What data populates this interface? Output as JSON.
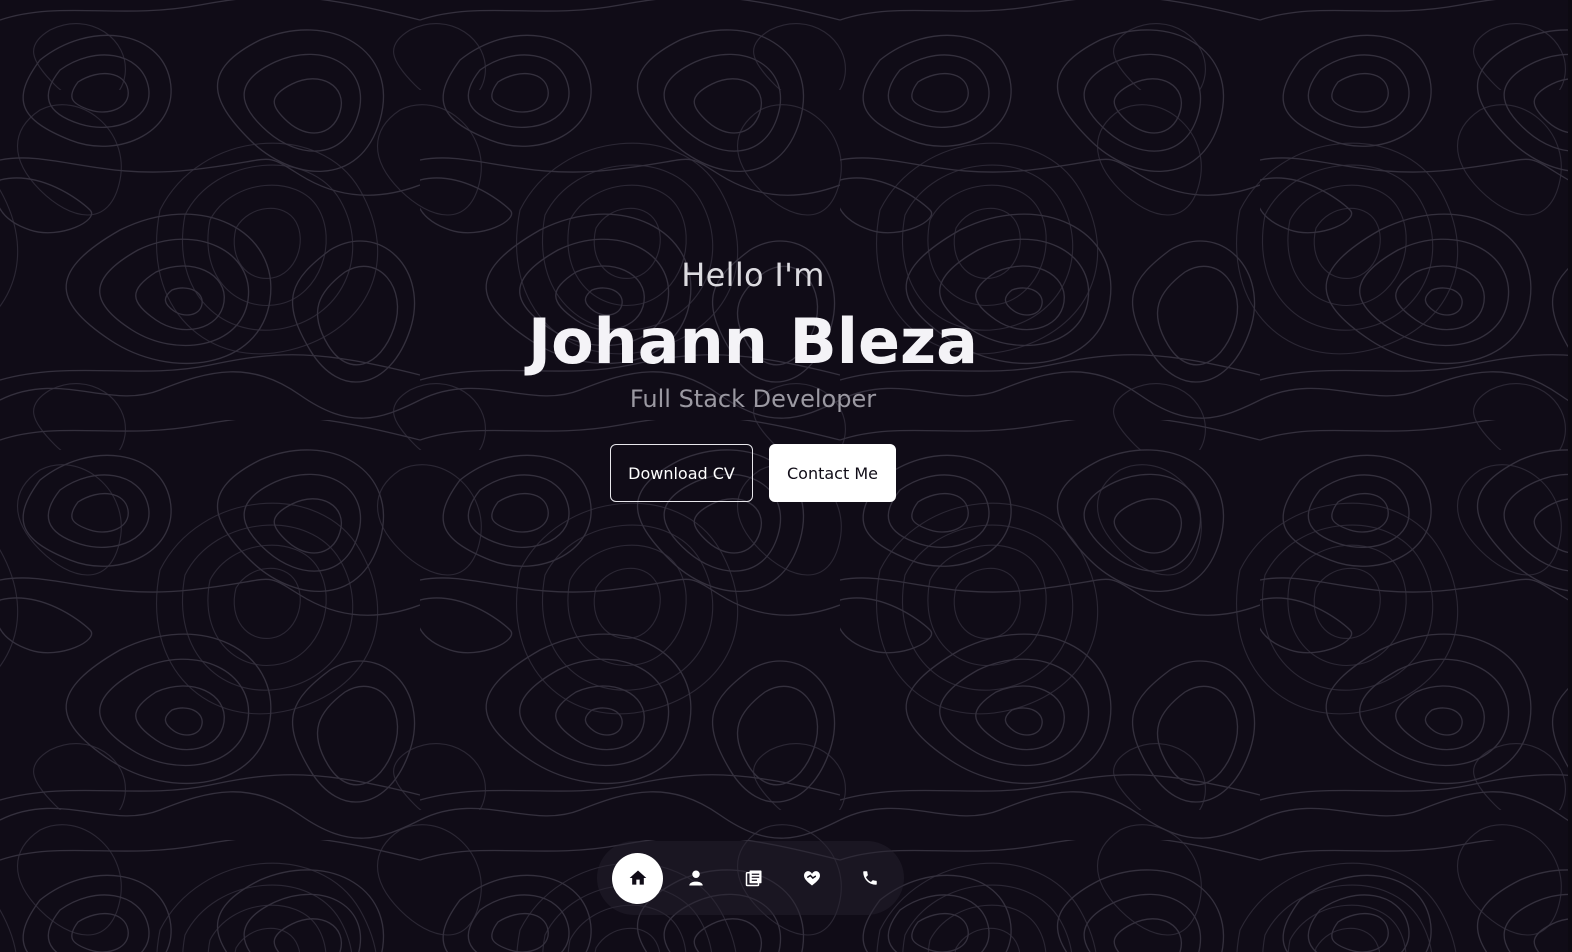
{
  "hero": {
    "greeting": "Hello I'm",
    "name": "Johann Bleza",
    "role": "Full Stack Developer",
    "download_label": "Download CV",
    "contact_label": "Contact Me"
  },
  "nav": {
    "items": [
      {
        "icon": "home-icon",
        "active": true
      },
      {
        "icon": "user-icon",
        "active": false
      },
      {
        "icon": "book-icon",
        "active": false
      },
      {
        "icon": "handshake-heart-icon",
        "active": false
      },
      {
        "icon": "phone-icon",
        "active": false
      }
    ]
  },
  "colors": {
    "background": "#100c17",
    "contour": "#3a3644",
    "text_primary": "#f4f3f7",
    "text_muted": "#9b99a2",
    "active_nav": "#ffffff"
  }
}
